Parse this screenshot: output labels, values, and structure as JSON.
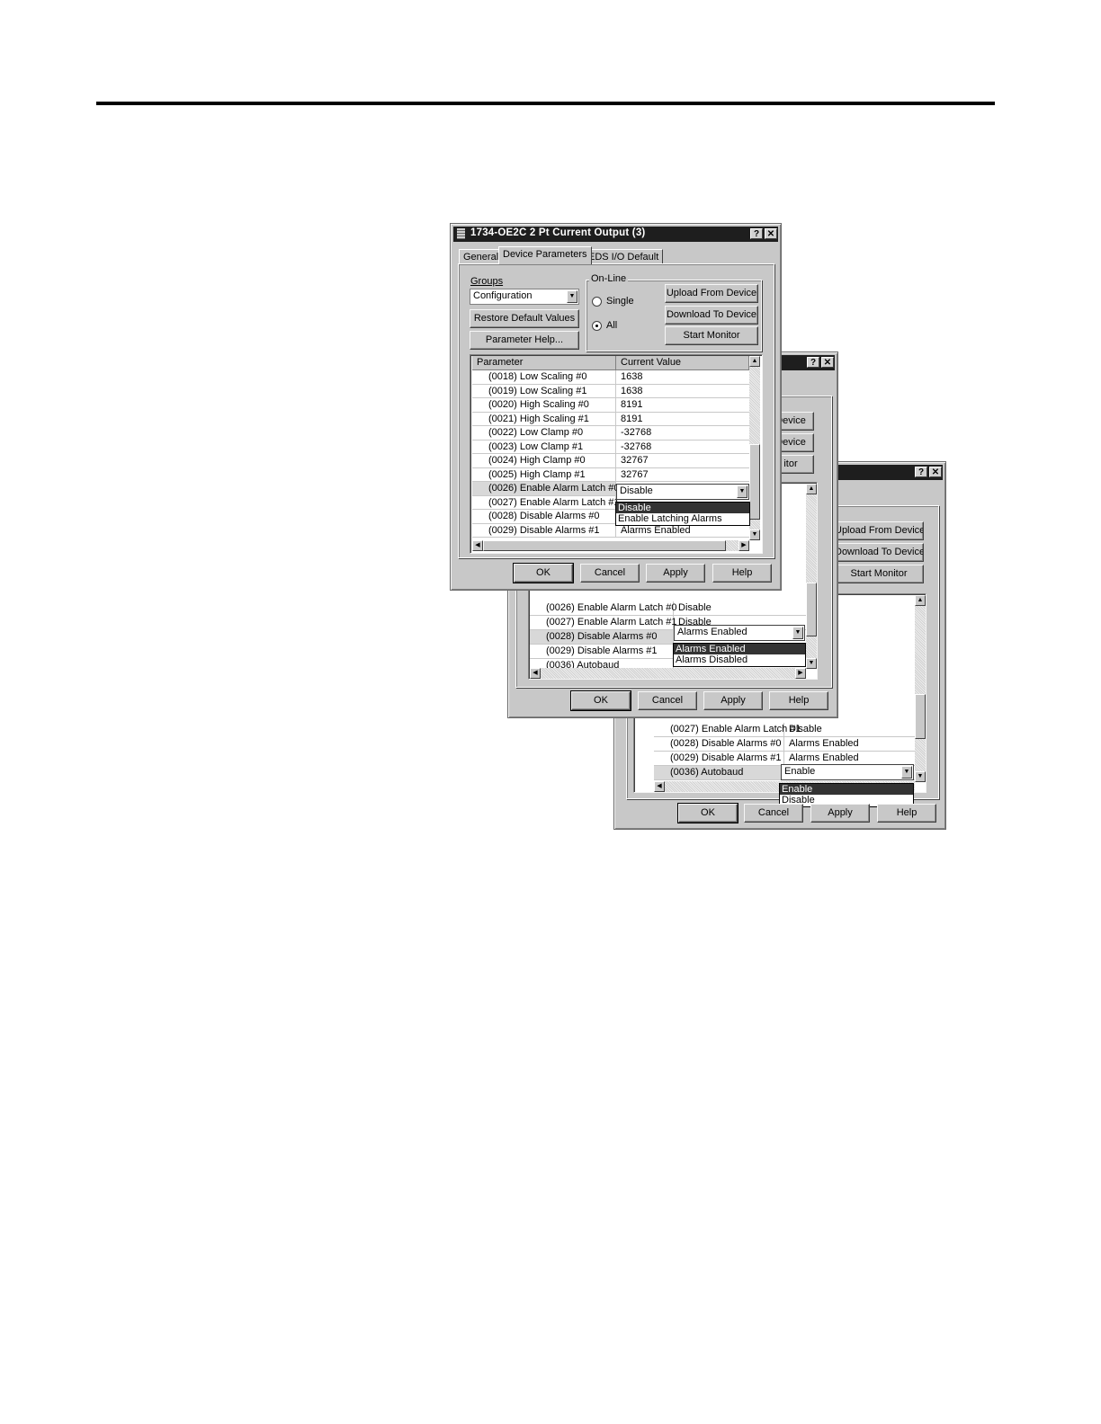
{
  "back_window": {
    "buttons": [
      "Upload From Device",
      "Download To Device",
      "Start Monitor"
    ],
    "rows": [
      {
        "param": "(0027) Enable Alarm Latch #1",
        "value": "Disable"
      },
      {
        "param": "(0028) Disable Alarms #0",
        "value": "Alarms Enabled"
      },
      {
        "param": "(0029) Disable Alarms #1",
        "value": "Alarms Enabled"
      },
      {
        "param": "(0036) Autobaud",
        "value": "Enable"
      }
    ],
    "dropdown_options": [
      "Enable",
      "Disable"
    ],
    "footer": {
      "ok": "OK",
      "cancel": "Cancel",
      "apply": "Apply",
      "help": "Help"
    }
  },
  "middle_window": {
    "buttons": [
      "Device",
      "Device",
      "itor"
    ],
    "rows": [
      {
        "param": "(0026) Enable Alarm Latch #0",
        "value": "Disable"
      },
      {
        "param": "(0027) Enable Alarm Latch #1",
        "value": "Disable"
      },
      {
        "param": "(0028) Disable Alarms #0",
        "value": "Alarms Enabled"
      },
      {
        "param": "(0029) Disable Alarms #1",
        "value": ""
      },
      {
        "param": "(0036) Autobaud",
        "value": ""
      }
    ],
    "dropdown_options": [
      "Alarms Enabled",
      "Alarms Disabled"
    ],
    "footer": {
      "ok": "OK",
      "cancel": "Cancel",
      "apply": "Apply",
      "help": "Help"
    }
  },
  "front_window": {
    "title": "1734-OE2C 2 Pt Current Output (3)",
    "tabs": [
      "General",
      "Device Parameters",
      "EDS I/O Default"
    ],
    "groups_label": "Groups",
    "groups_value": "Configuration",
    "restore_button": "Restore Default Values",
    "param_help_button": "Parameter Help...",
    "online_label": "On-Line",
    "radio_single": "Single",
    "radio_all": "All",
    "upload_button": "Upload From Device",
    "download_button": "Download To Device",
    "monitor_button": "Start Monitor",
    "col_param": "Parameter",
    "col_value": "Current Value",
    "rows": [
      {
        "param": "(0018) Low Scaling #0",
        "value": "1638"
      },
      {
        "param": "(0019) Low Scaling #1",
        "value": "1638"
      },
      {
        "param": "(0020) High Scaling #0",
        "value": "8191"
      },
      {
        "param": "(0021) High Scaling #1",
        "value": "8191"
      },
      {
        "param": "(0022) Low Clamp #0",
        "value": "-32768"
      },
      {
        "param": "(0023) Low Clamp #1",
        "value": "-32768"
      },
      {
        "param": "(0024) High Clamp #0",
        "value": "32767"
      },
      {
        "param": "(0025) High Clamp #1",
        "value": "32767"
      },
      {
        "param": "(0026) Enable Alarm Latch #0",
        "value": "Disable"
      },
      {
        "param": "(0027) Enable Alarm Latch #1",
        "value": ""
      },
      {
        "param": "(0028) Disable Alarms #0",
        "value": ""
      },
      {
        "param": "(0029) Disable Alarms #1",
        "value": "Alarms Enabled"
      }
    ],
    "dropdown_options": [
      "Disable",
      "Enable Latching Alarms"
    ],
    "footer": {
      "ok": "OK",
      "cancel": "Cancel",
      "apply": "Apply",
      "help": "Help"
    }
  },
  "title_buttons": {
    "help": "?",
    "close": "✕"
  }
}
